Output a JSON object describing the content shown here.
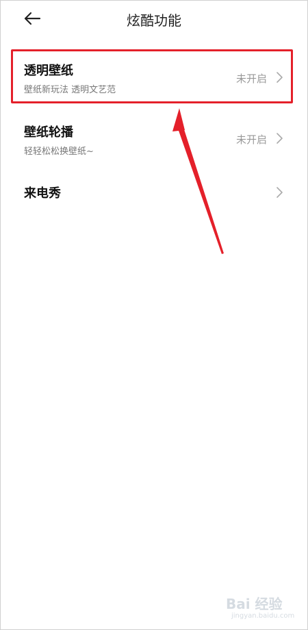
{
  "header": {
    "title": "炫酷功能",
    "back_icon": "arrow-left-icon"
  },
  "settings": {
    "items": [
      {
        "title": "透明壁纸",
        "subtitle": "壁纸新玩法 透明文艺范",
        "status": "未开启",
        "icon": "chevron-right-icon"
      },
      {
        "title": "壁纸轮播",
        "subtitle": "轻轻松松换壁纸~",
        "status": "未开启",
        "icon": "chevron-right-icon"
      },
      {
        "title": "来电秀",
        "icon": "chevron-right-icon"
      }
    ]
  },
  "annotation": {
    "color": "#e4202a"
  },
  "watermark": {
    "main": "Bai 经验",
    "sub": "jingyan.baidu.com"
  },
  "colors": {
    "background": "#ffffff",
    "title_text": "#111111",
    "subtitle_text": "#777777",
    "status_text": "#999999",
    "highlight": "#e4202a"
  }
}
